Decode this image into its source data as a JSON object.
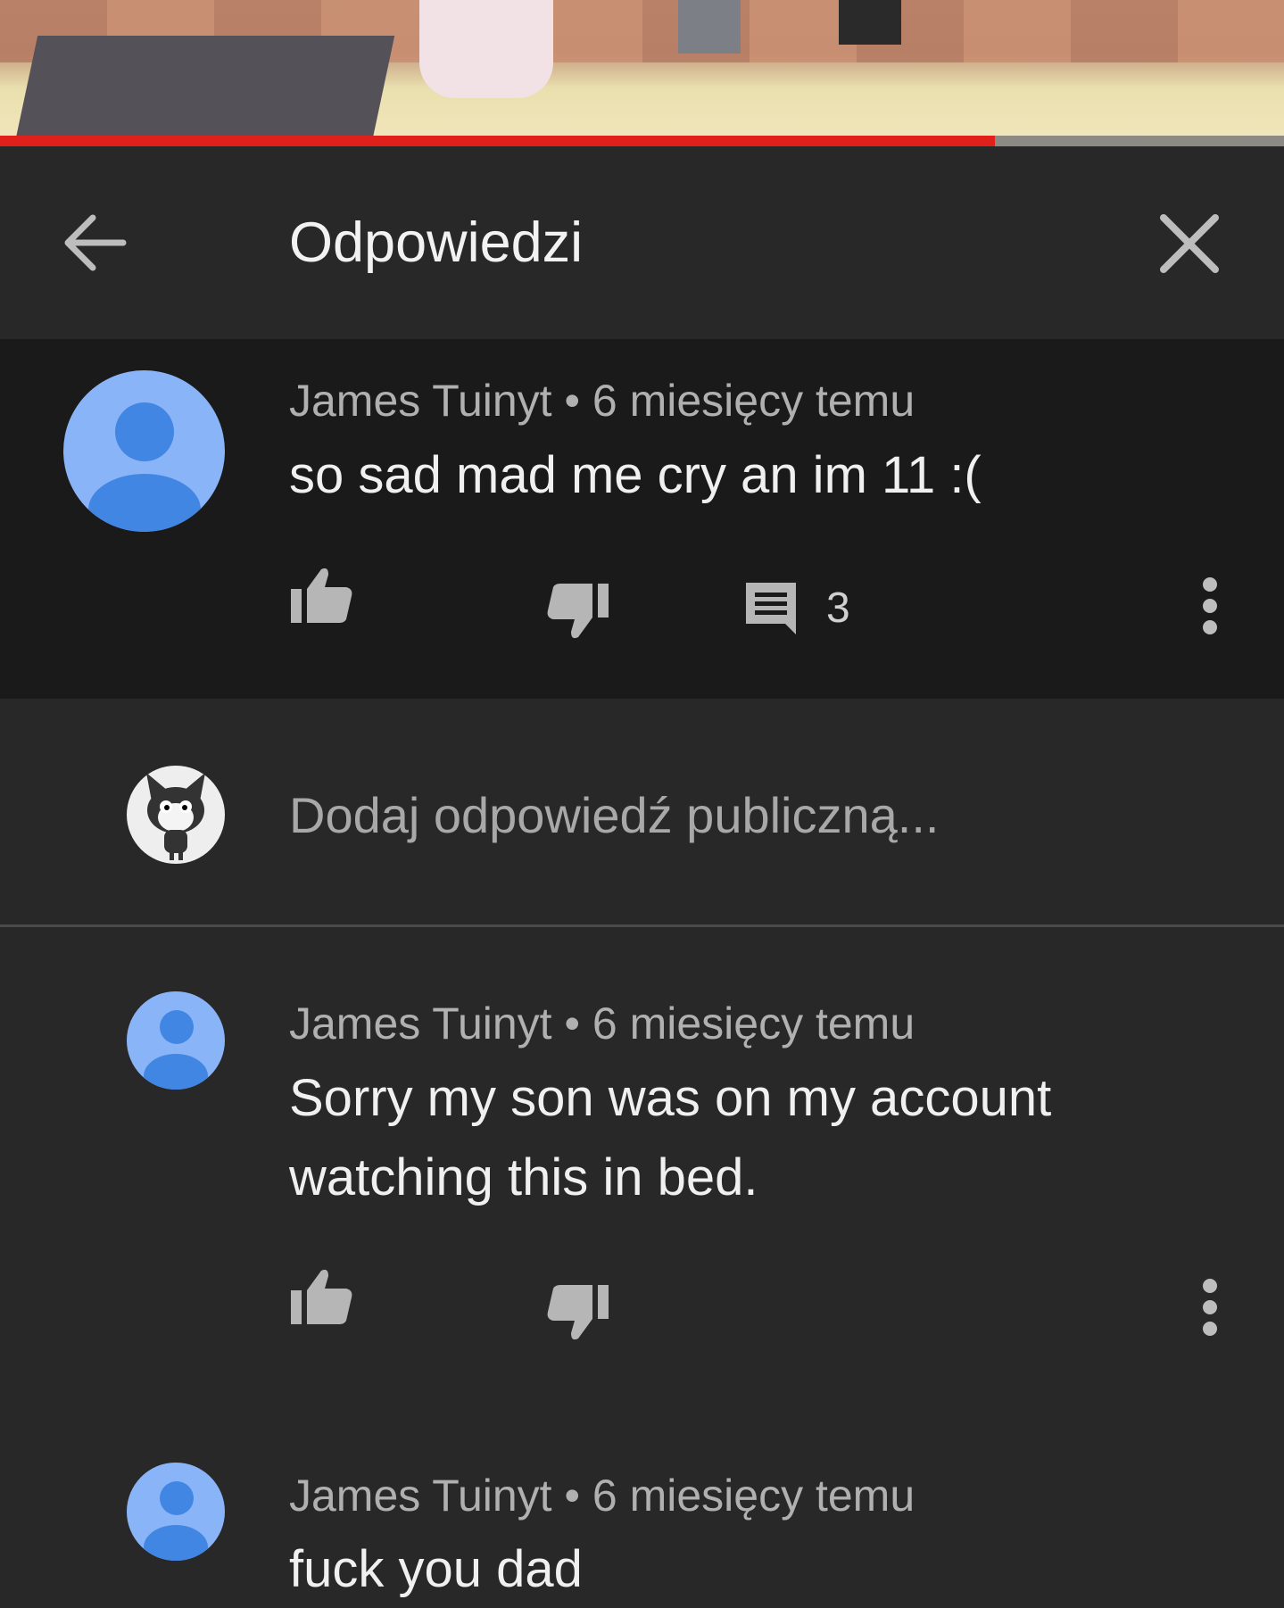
{
  "video": {
    "progress_fraction": 0.775
  },
  "header": {
    "title": "Odpowiedzi",
    "back_icon": "arrow-left-icon",
    "close_icon": "close-icon"
  },
  "parent_comment": {
    "author": "James Tuinyt",
    "time": "6 miesięcy temu",
    "separator": "•",
    "text": "so sad mad me cry an im 11 :(",
    "reply_count": "3"
  },
  "reply_box": {
    "placeholder": "Dodaj odpowiedź publiczną..."
  },
  "replies": [
    {
      "author": "James Tuinyt",
      "time": "6 miesięcy temu",
      "separator": "•",
      "text": "Sorry my son was on my account watching this in bed."
    },
    {
      "author": "James Tuinyt",
      "time": "6 miesięcy temu",
      "separator": "•",
      "text": "fuck you dad"
    }
  ],
  "colors": {
    "background": "#282828",
    "highlight": "#1a1a1a",
    "progress": "#e0201b",
    "avatar_light": "#8ab4f8",
    "avatar_dark": "#4286e4"
  }
}
